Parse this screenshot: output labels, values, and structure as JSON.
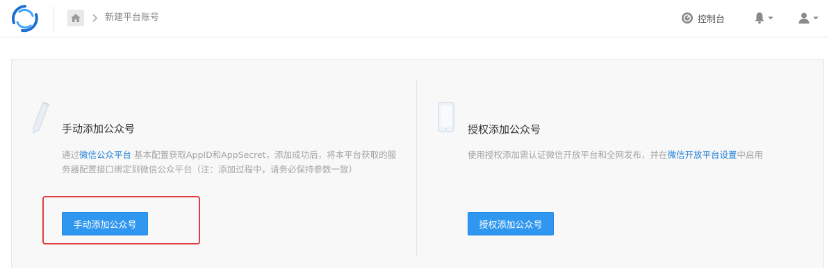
{
  "header": {
    "breadcrumb": "新建平台账号",
    "console_label": "控制台",
    "icons": {
      "logo": "app-logo-icon",
      "home": "home-icon",
      "console": "console-icon",
      "bell": "bell-icon",
      "user": "user-icon"
    }
  },
  "manual": {
    "title": "手动添加公众号",
    "desc_prefix": "通过",
    "desc_link": "微信公众平台",
    "desc_suffix": " 基本配置获取AppID和AppSecret，添加成功后，将本平台获取的服务器配置接口绑定到微信公众平台（注：添加过程中，请务必保持参数一致）",
    "button_label": "手动添加公众号",
    "icon": "pen-icon"
  },
  "authorize": {
    "title": "授权添加公众号",
    "desc_prefix": "使用授权添加需认证微信开放平台和全网发布，并在",
    "desc_link": "微信开放平台设置",
    "desc_suffix": "中启用",
    "button_label": "授权添加公众号",
    "icon": "phone-icon"
  },
  "colors": {
    "primary": "#2f97ef",
    "link": "#1f7fd6",
    "highlight": "#e23b3b",
    "muted_text": "#a3a3a3"
  }
}
